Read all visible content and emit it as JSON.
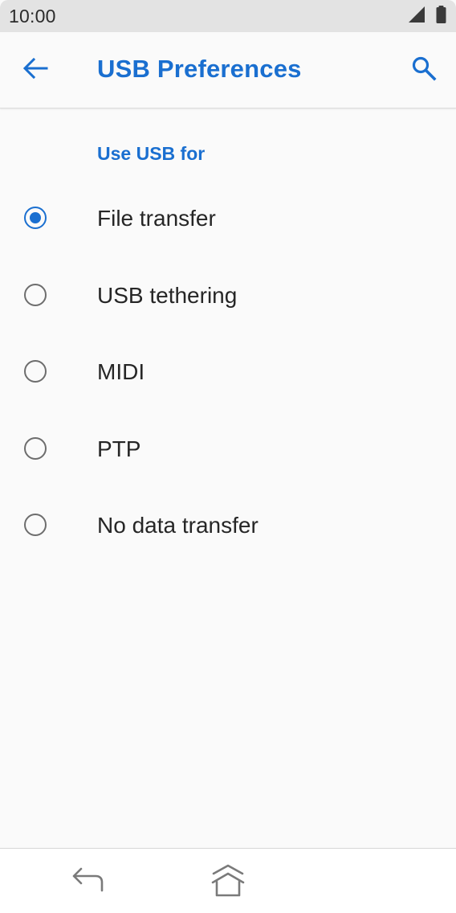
{
  "status_bar": {
    "time": "10:00",
    "icons": [
      "signal-icon",
      "battery-icon"
    ]
  },
  "app_bar": {
    "title": "USB Preferences",
    "back_icon": "arrow-back-icon",
    "search_icon": "search-icon"
  },
  "section": {
    "header": "Use USB for"
  },
  "options": [
    {
      "label": "File transfer",
      "selected": true
    },
    {
      "label": "USB tethering",
      "selected": false
    },
    {
      "label": "MIDI",
      "selected": false
    },
    {
      "label": "PTP",
      "selected": false
    },
    {
      "label": "No data transfer",
      "selected": false
    }
  ],
  "nav_bar": {
    "icons": [
      "nav-back-icon",
      "nav-home-icon"
    ]
  },
  "colors": {
    "accent": "#1a6fd0",
    "text_primary": "#262626",
    "radio_unchecked": "#6d6d6d",
    "background": "#fafafa",
    "status_bar_bg": "#e3e3e3"
  }
}
